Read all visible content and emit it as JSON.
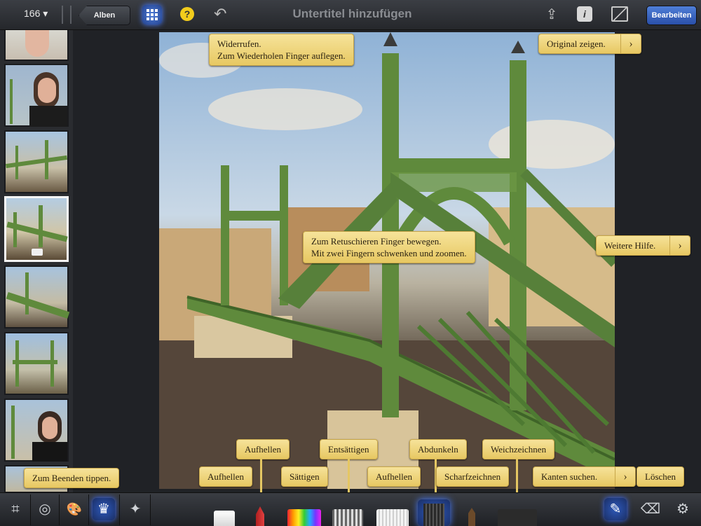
{
  "toolbar": {
    "photo_count": "166 ▾",
    "albums_label": "Alben",
    "help_glyph": "?",
    "undo_glyph": "↶",
    "title": "Untertitel hinzufügen",
    "share_glyph": "⇪",
    "info_glyph": "i",
    "edit_label": "Bearbeiten",
    "icons": [
      "grid-icon",
      "help-icon",
      "undo-icon",
      "share-icon",
      "info-icon",
      "compare-icon"
    ]
  },
  "tips": {
    "undo_line1": "Widerrufen.",
    "undo_line2": "Zum Wiederholen Finger auflegen.",
    "original": "Original zeigen.",
    "retouch_line1": "Zum Retuschieren Finger bewegen.",
    "retouch_line2": "Mit zwei Fingern schwenken und zoomen.",
    "more_help": "Weitere Hilfe.",
    "finish": "Zum Beenden tippen.",
    "brighten_upper": "Aufhellen",
    "desaturate": "Entsättigen",
    "darken": "Abdunkeln",
    "blur": "Weichzeichnen",
    "brighten_left": "Aufhellen",
    "saturate": "Sättigen",
    "brighten_right": "Aufhellen",
    "sharpen": "Scharfzeichnen",
    "find_edges": "Kanten suchen.",
    "erase": "Löschen",
    "arrow": "›"
  },
  "bottom_tools": {
    "icons": [
      "crop-icon",
      "exposure-icon",
      "color-palette-icon",
      "brushes-icon",
      "effects-icon"
    ],
    "glyphs": [
      "⌗",
      "◎",
      "🎨",
      "♛",
      "✦"
    ],
    "right_icons": [
      "brush-edit-icon",
      "eraser-icon",
      "gear-icon"
    ],
    "right_glyphs": [
      "✎",
      "⌫",
      "⚙"
    ]
  },
  "colors": {
    "accent": "#3d6cff",
    "tip_bg": "#f0d77a",
    "bridge_green": "#5f8a3c"
  }
}
